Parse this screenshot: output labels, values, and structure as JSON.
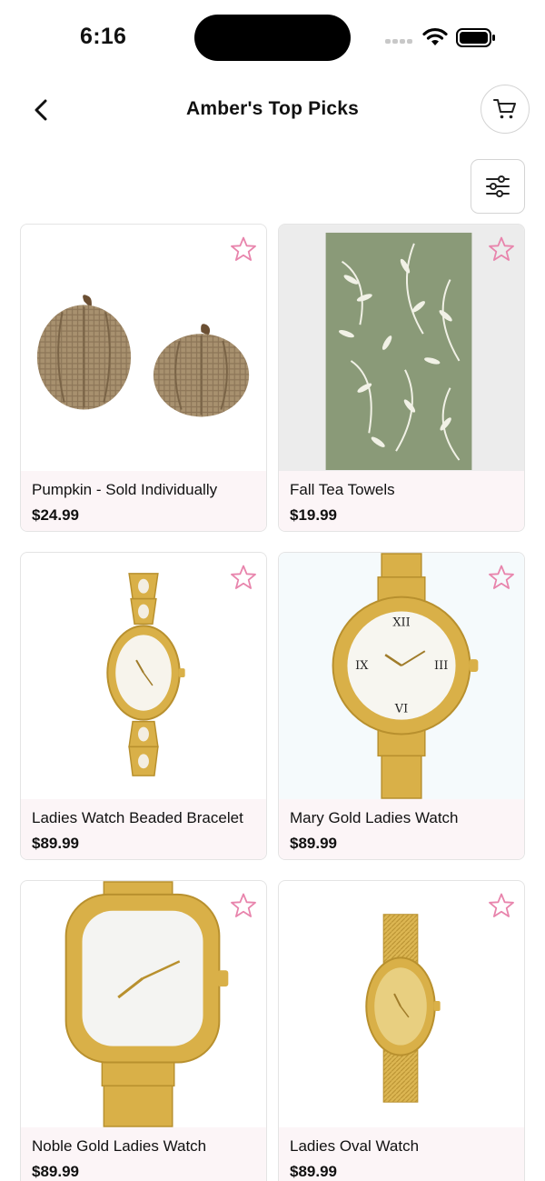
{
  "status_bar": {
    "time": "6:16"
  },
  "header": {
    "title": "Amber's Top Picks"
  },
  "icons": {
    "back": "chevron-left-icon",
    "cart": "cart-icon",
    "filter": "sliders-icon",
    "favorite": "star-outline-icon"
  },
  "colors": {
    "accent_pink": "#e884ac",
    "card_footer": "#fcf5f7",
    "gold": "#d9b048"
  },
  "products": [
    {
      "name": "Pumpkin - Sold Individually",
      "price": "$24.99"
    },
    {
      "name": "Fall Tea Towels",
      "price": "$19.99"
    },
    {
      "name": "Ladies Watch Beaded Bracelet",
      "price": "$89.99"
    },
    {
      "name": "Mary Gold Ladies Watch",
      "price": "$89.99"
    },
    {
      "name": "Noble Gold Ladies Watch",
      "price": "$89.99"
    },
    {
      "name": "Ladies Oval Watch",
      "price": "$89.99"
    }
  ]
}
